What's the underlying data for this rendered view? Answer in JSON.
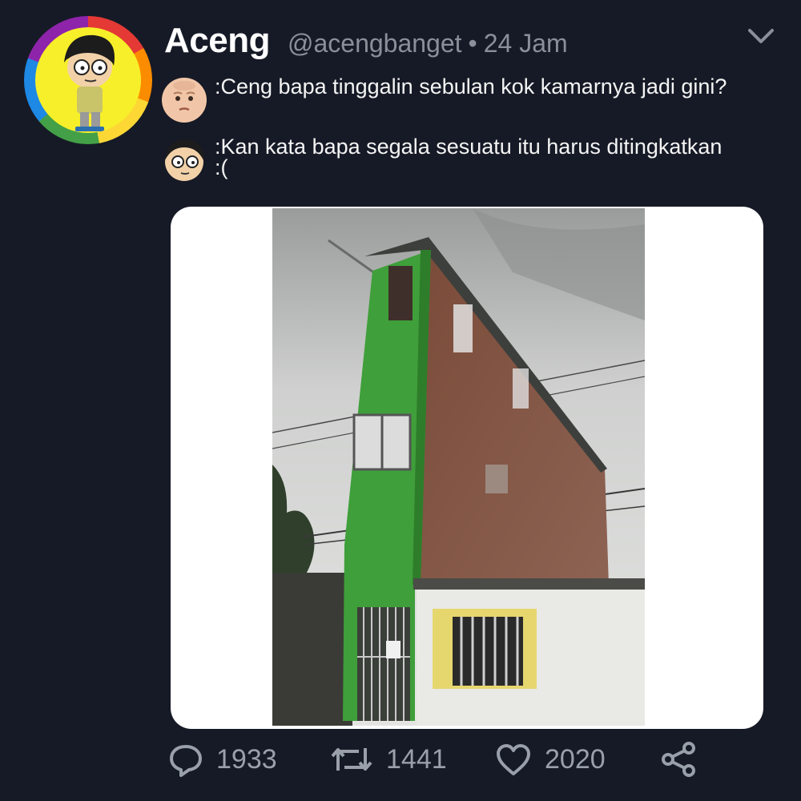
{
  "tweet": {
    "display_name": "Aceng",
    "handle": "@acengbanget",
    "separator": "•",
    "time": "24 Jam",
    "menu_icon": "chevron-down-icon"
  },
  "dialogue": [
    {
      "speaker_icon": "baby-face-icon",
      "text": ":Ceng bapa tinggalin sebulan kok kamarnya jadi gini?"
    },
    {
      "speaker_icon": "cartoon-boy-face-icon",
      "text": ":Kan kata bapa segala sesuatu itu harus ditingkatkan :("
    }
  ],
  "actions": {
    "reply_count": "1933",
    "retweet_count": "1441",
    "like_count": "2020",
    "share_icon": "share-icon"
  },
  "colors": {
    "background": "#161a26",
    "muted_text": "#8a8f99",
    "card": "#ffffff",
    "building_green": "#3f9f3a"
  }
}
